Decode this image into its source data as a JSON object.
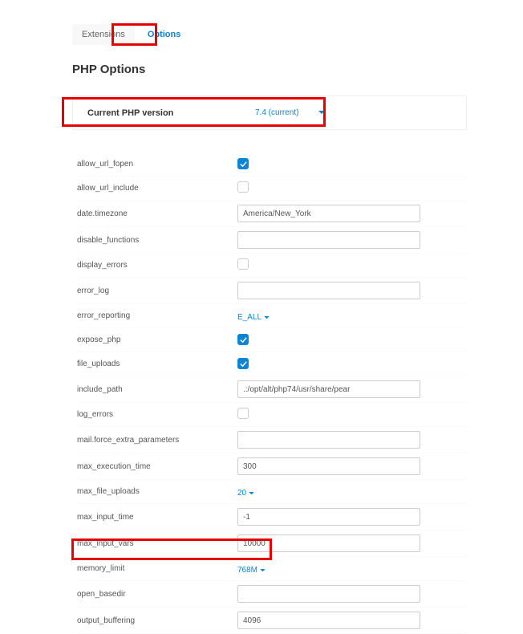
{
  "tabs": {
    "extensions": "Extensions",
    "options": "Options"
  },
  "page_title": "PHP Options",
  "version": {
    "label": "Current PHP version",
    "value": "7.4 (current)"
  },
  "options": [
    {
      "name": "allow_url_fopen",
      "type": "check",
      "checked": true
    },
    {
      "name": "allow_url_include",
      "type": "check",
      "checked": false
    },
    {
      "name": "date.timezone",
      "type": "text",
      "value": "America/New_York"
    },
    {
      "name": "disable_functions",
      "type": "text",
      "value": ""
    },
    {
      "name": "display_errors",
      "type": "check",
      "checked": false
    },
    {
      "name": "error_log",
      "type": "text",
      "value": ""
    },
    {
      "name": "error_reporting",
      "type": "select",
      "value": "E_ALL"
    },
    {
      "name": "expose_php",
      "type": "check",
      "checked": true
    },
    {
      "name": "file_uploads",
      "type": "check",
      "checked": true
    },
    {
      "name": "include_path",
      "type": "text",
      "value": ".:/opt/alt/php74/usr/share/pear"
    },
    {
      "name": "log_errors",
      "type": "check",
      "checked": false
    },
    {
      "name": "mail.force_extra_parameters",
      "type": "text",
      "value": ""
    },
    {
      "name": "max_execution_time",
      "type": "text",
      "value": "300"
    },
    {
      "name": "max_file_uploads",
      "type": "select",
      "value": "20"
    },
    {
      "name": "max_input_time",
      "type": "text",
      "value": "-1"
    },
    {
      "name": "max_input_vars",
      "type": "text",
      "value": "10000"
    },
    {
      "name": "memory_limit",
      "type": "select",
      "value": "768M"
    },
    {
      "name": "open_basedir",
      "type": "text",
      "value": ""
    },
    {
      "name": "output_buffering",
      "type": "text",
      "value": "4096"
    }
  ]
}
